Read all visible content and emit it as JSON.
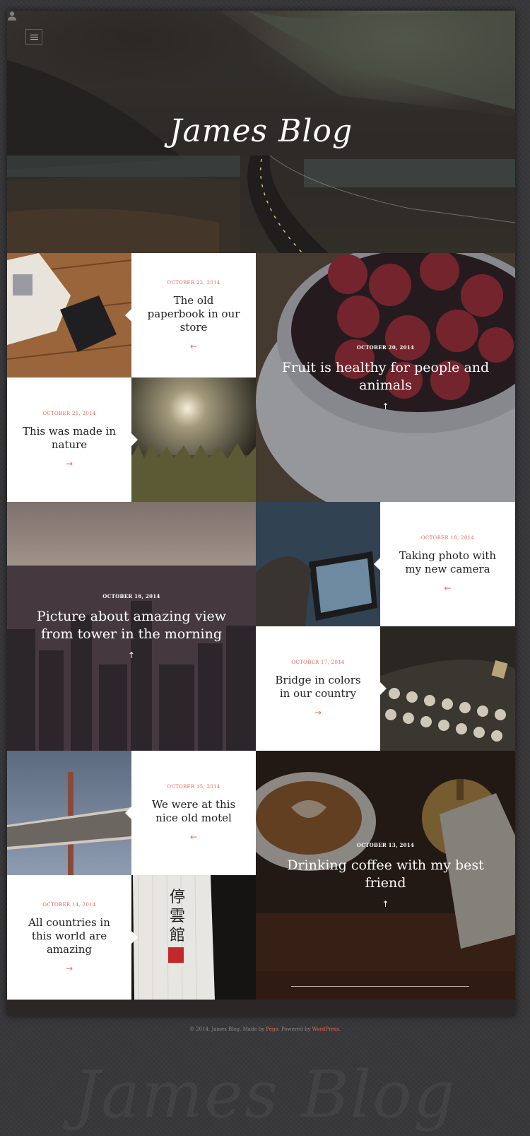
{
  "header": {
    "title": "James Blog",
    "menu_icon": "hamburger-icon",
    "user_icon": "user-icon"
  },
  "posts": [
    {
      "date": "OCTOBER 22, 2014",
      "title": "The old paperbook in our store",
      "arrow": "←"
    },
    {
      "date": "OCTOBER 21, 2014",
      "title": "This was made in nature",
      "arrow": "→"
    },
    {
      "date": "OCTOBER 20, 2014",
      "title": "Fruit is healthy for people and animals",
      "arrow": "↑"
    },
    {
      "date": "OCTOBER 16, 2014",
      "title": "Picture about amazing view from tower in the morning",
      "arrow": "↑"
    },
    {
      "date": "OCTOBER 18, 2014",
      "title": "Taking photo with my new camera",
      "arrow": "←"
    },
    {
      "date": "OCTOBER 17, 2014",
      "title": "Bridge in colors in our country",
      "arrow": "→"
    },
    {
      "date": "OCTOBER 15, 2014",
      "title": "We were at this nice old motel",
      "arrow": "←"
    },
    {
      "date": "OCTOBER 14, 2014",
      "title": "All countries in this world are amazing",
      "arrow": "→"
    },
    {
      "date": "OCTOBER 13, 2014",
      "title": "Drinking coffee with my best friend",
      "arrow": "↑"
    }
  ],
  "lantern_text": "停雲館",
  "footer": {
    "prefix": "© 2014, James Blog. Made by ",
    "maker": "Pego",
    "middle": ". Powered by ",
    "platform": "WordPress",
    "suffix": "."
  },
  "watermark": "James Blog",
  "colors": {
    "accent": "#e46a55",
    "background": "#38383a",
    "card": "#ffffff"
  }
}
